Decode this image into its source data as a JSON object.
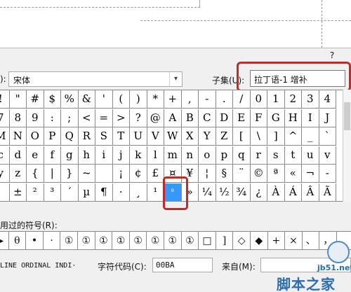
{
  "dialog": {
    "help_label": "?"
  },
  "font": {
    "label_tail": "):",
    "value": "宋体",
    "arrow_icon": "chevron-down-icon"
  },
  "subset": {
    "label": "子集(U):",
    "value": "拉丁语-1 增补"
  },
  "grid": {
    "selected": "º",
    "rows": [
      [
        "!",
        "\"",
        "#",
        "$",
        "%",
        "&",
        "'",
        "(",
        ")",
        "*",
        "+",
        ",",
        "-",
        ".",
        "/",
        "0",
        "1",
        "2",
        "3",
        "4"
      ],
      [
        "7",
        "8",
        "9",
        ":",
        ";",
        "<",
        "=",
        ">",
        "?",
        "@",
        "A",
        "B",
        "C",
        "D",
        "E",
        "F",
        "G",
        "H",
        "I",
        "J"
      ],
      [
        "M",
        "N",
        "O",
        "P",
        "Q",
        "R",
        "S",
        "T",
        "U",
        "V",
        "W",
        "X",
        "Y",
        "Z",
        "[",
        "\\",
        "]",
        "^",
        "_",
        "`"
      ],
      [
        "c",
        "d",
        "e",
        "f",
        "g",
        "h",
        "i",
        "j",
        "k",
        "l",
        "m",
        "n",
        "o",
        "p",
        "q",
        "r",
        "s",
        "t",
        "u",
        "v"
      ],
      [
        "y",
        "z",
        "{",
        "|",
        "}",
        "~",
        "",
        "¡",
        "¢",
        "£",
        "¤",
        "¥",
        "¦",
        "§",
        "¨",
        "©",
        "ª",
        "«",
        "¬",
        "-"
      ],
      [
        "",
        "±",
        "²",
        "³",
        "´",
        "µ",
        "¶",
        "·",
        "¸",
        "¹",
        "º",
        "»",
        "¼",
        "½",
        "¾",
        "¿",
        "À",
        "Á",
        "Â",
        "Ã"
      ]
    ]
  },
  "recent": {
    "label": "用过的符号(R):",
    "items": [
      "▶",
      "θ",
      "•",
      "·",
      "①",
      "①",
      "①",
      "①",
      "①",
      "①",
      "①",
      "①",
      "□",
      "]",
      "◇",
      "◆",
      "+",
      "×",
      "、",
      "，"
    ]
  },
  "footer": {
    "char_name": "LINE ORDINAL INDI·",
    "code_label": "字符代码(C):",
    "code_value": "00BA",
    "from_label": "来自(M):"
  },
  "watermark": {
    "site": "jb51.net",
    "name": "脚本之家"
  }
}
